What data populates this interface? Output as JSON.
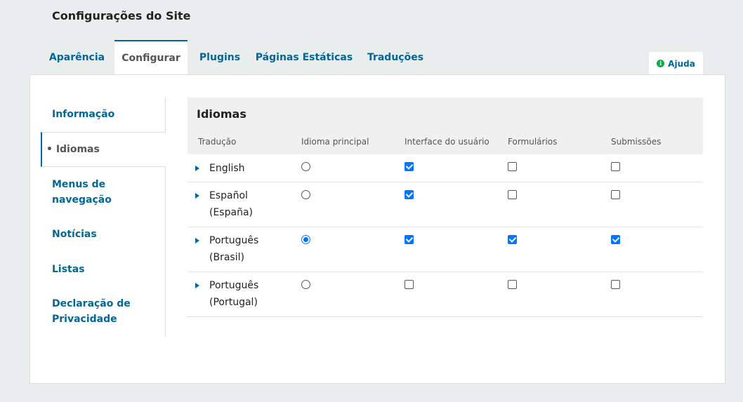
{
  "page": {
    "title": "Configurações do Site"
  },
  "tabs": [
    {
      "label": "Aparência"
    },
    {
      "label": "Configurar"
    },
    {
      "label": "Plugins"
    },
    {
      "label": "Páginas Estáticas"
    },
    {
      "label": "Traduções"
    }
  ],
  "help": {
    "label": "Ajuda",
    "icon": "info-icon"
  },
  "sidenav": {
    "items": [
      {
        "label": "Informação"
      },
      {
        "label": "• Idiomas"
      },
      {
        "label": "Menus de navegação"
      },
      {
        "label": "Notícias"
      },
      {
        "label": "Listas"
      },
      {
        "label": "Declaração de Privacidade"
      }
    ]
  },
  "grid": {
    "title": "Idiomas",
    "columns": [
      "Tradução",
      "Idioma principal",
      "Interface do usuário",
      "Formulários",
      "Submissões"
    ],
    "rows": [
      {
        "name": "English",
        "primary": false,
        "ui": true,
        "forms": false,
        "submissions": false
      },
      {
        "name": "Español (España)",
        "primary": false,
        "ui": true,
        "forms": false,
        "submissions": false
      },
      {
        "name": "Português (Brasil)",
        "primary": true,
        "ui": true,
        "forms": true,
        "submissions": true
      },
      {
        "name": "Português (Portugal)",
        "primary": false,
        "ui": false,
        "forms": false,
        "submissions": false
      }
    ]
  },
  "colors": {
    "accent": "#006798",
    "check": "#0075ff",
    "help_icon": "#00b24e"
  }
}
